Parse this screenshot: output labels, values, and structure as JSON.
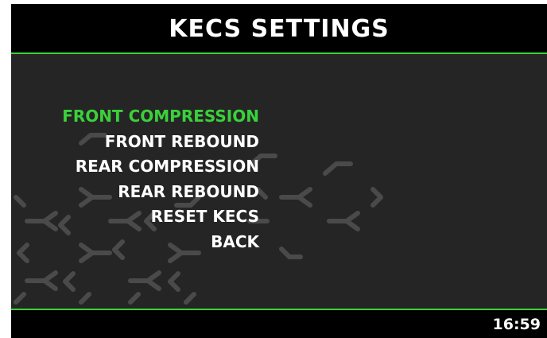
{
  "header": {
    "title": "KECS SETTINGS"
  },
  "menu": {
    "items": [
      {
        "label": "FRONT COMPRESSION",
        "selected": true
      },
      {
        "label": "FRONT REBOUND",
        "selected": false
      },
      {
        "label": "REAR COMPRESSION",
        "selected": false
      },
      {
        "label": "REAR REBOUND",
        "selected": false
      },
      {
        "label": "RESET KECS",
        "selected": false
      },
      {
        "label": "BACK",
        "selected": false
      }
    ]
  },
  "status": {
    "time": "16:59"
  },
  "colors": {
    "accent": "#3ad13a",
    "background": "#252525",
    "bar": "#000000",
    "text": "#ffffff",
    "pattern": "#4a4a4a"
  },
  "background_icon": "hexagon-lattice-pattern"
}
